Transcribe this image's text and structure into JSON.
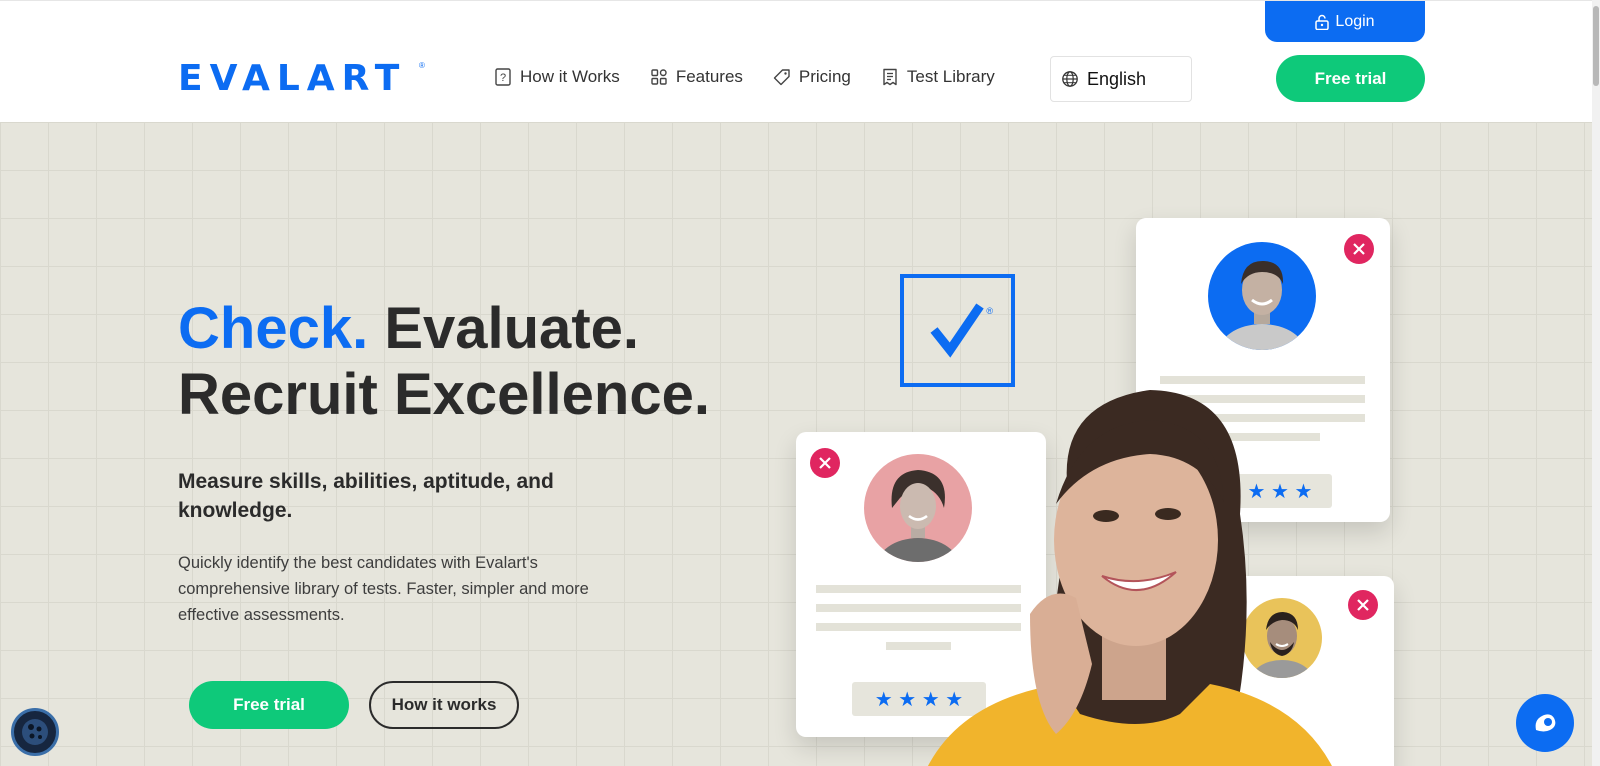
{
  "brand": {
    "logo": "EVALART",
    "registered": "®",
    "primary_color": "#0c6cf2",
    "green": "#0ec97a",
    "red": "#e02660"
  },
  "header": {
    "login": {
      "label": "Login",
      "icon": "lock-open-icon"
    },
    "nav": [
      {
        "label": "How it Works",
        "icon": "question-doc-icon"
      },
      {
        "label": "Features",
        "icon": "grid-icon"
      },
      {
        "label": "Pricing",
        "icon": "tag-icon"
      },
      {
        "label": "Test Library",
        "icon": "document-list-icon"
      }
    ],
    "language": {
      "value": "English",
      "icon": "globe-icon"
    },
    "free_trial": "Free trial"
  },
  "hero": {
    "headline_blue": "Check.",
    "headline_rest": " Evaluate.",
    "headline_line2": "Recruit Excellence.",
    "subhead": "Measure skills, abilities, aptitude, and knowledge.",
    "description": "Quickly identify the best candidates with Evalart's comprehensive library of tests. Faster, simpler and more effective assessments.",
    "cta_primary": "Free trial",
    "cta_secondary": "How it works"
  },
  "visual": {
    "badge_registered": "®",
    "card1_stars": "★ ★ ★",
    "card2_stars": "★ ★ ★ ★"
  },
  "widgets": {
    "cookie_icon": "cookie-icon",
    "chat_icon": "chat-icon"
  }
}
